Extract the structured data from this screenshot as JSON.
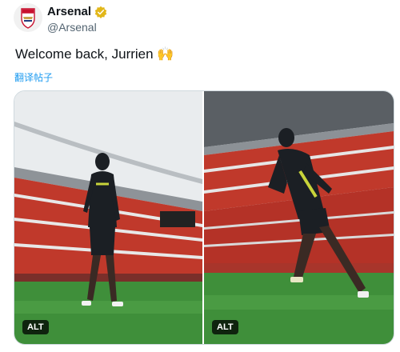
{
  "author": {
    "name": "Arsenal",
    "handle": "@Arsenal",
    "verified_badge_color": "#e2b719",
    "avatar_icon": "arsenal-crest-icon"
  },
  "tweet": {
    "text": "Welcome back, Jurrien 🙌",
    "translate_label": "翻译帖子"
  },
  "media": {
    "photos": [
      {
        "alt_label": "ALT"
      },
      {
        "alt_label": "ALT"
      }
    ]
  },
  "colors": {
    "link_blue": "#1d9bf0",
    "stadium_red": "#c0392b",
    "pitch_green": "#3f8f3a"
  }
}
